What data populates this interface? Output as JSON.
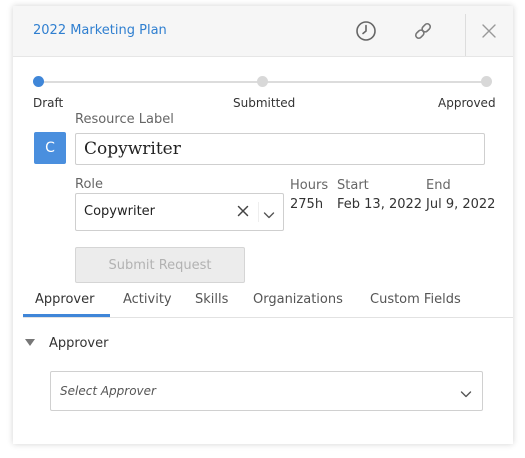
{
  "header": {
    "title": "2022 Marketing Plan",
    "icons": [
      "clock-icon",
      "link-icon",
      "close-icon"
    ]
  },
  "progress": {
    "stages": [
      "Draft",
      "Submitted",
      "Approved"
    ],
    "current_stage": "Draft",
    "accent": "#3f86d8"
  },
  "avatar": {
    "initial": "C",
    "color": "#4a8fde"
  },
  "resource": {
    "label": "Resource Label",
    "value": "Copywriter"
  },
  "role": {
    "label": "Role",
    "value": "Copywriter"
  },
  "info": {
    "hours_label": "Hours",
    "hours_value": "275h",
    "start_label": "Start",
    "start_value": "Feb 13, 2022",
    "end_label": "End",
    "end_value": "Jul 9, 2022"
  },
  "submit_label": "Submit Request",
  "tabs": [
    {
      "label": "Approver",
      "active": true
    },
    {
      "label": "Activity"
    },
    {
      "label": "Skills"
    },
    {
      "label": "Organizations"
    },
    {
      "label": "Custom Fields"
    }
  ],
  "approver": {
    "section_title": "Approver",
    "placeholder": "Select Approver"
  }
}
